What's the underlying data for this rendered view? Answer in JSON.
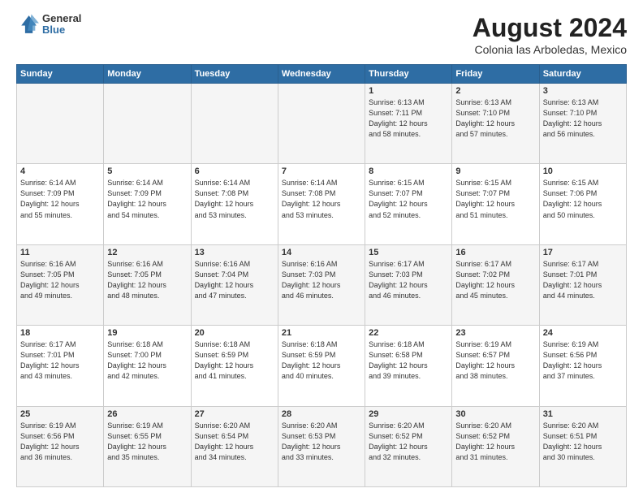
{
  "header": {
    "logo_general": "General",
    "logo_blue": "Blue",
    "title": "August 2024",
    "subtitle": "Colonia las Arboledas, Mexico"
  },
  "days_of_week": [
    "Sunday",
    "Monday",
    "Tuesday",
    "Wednesday",
    "Thursday",
    "Friday",
    "Saturday"
  ],
  "weeks": [
    [
      {
        "day": "",
        "info": ""
      },
      {
        "day": "",
        "info": ""
      },
      {
        "day": "",
        "info": ""
      },
      {
        "day": "",
        "info": ""
      },
      {
        "day": "1",
        "info": "Sunrise: 6:13 AM\nSunset: 7:11 PM\nDaylight: 12 hours\nand 58 minutes."
      },
      {
        "day": "2",
        "info": "Sunrise: 6:13 AM\nSunset: 7:10 PM\nDaylight: 12 hours\nand 57 minutes."
      },
      {
        "day": "3",
        "info": "Sunrise: 6:13 AM\nSunset: 7:10 PM\nDaylight: 12 hours\nand 56 minutes."
      }
    ],
    [
      {
        "day": "4",
        "info": "Sunrise: 6:14 AM\nSunset: 7:09 PM\nDaylight: 12 hours\nand 55 minutes."
      },
      {
        "day": "5",
        "info": "Sunrise: 6:14 AM\nSunset: 7:09 PM\nDaylight: 12 hours\nand 54 minutes."
      },
      {
        "day": "6",
        "info": "Sunrise: 6:14 AM\nSunset: 7:08 PM\nDaylight: 12 hours\nand 53 minutes."
      },
      {
        "day": "7",
        "info": "Sunrise: 6:14 AM\nSunset: 7:08 PM\nDaylight: 12 hours\nand 53 minutes."
      },
      {
        "day": "8",
        "info": "Sunrise: 6:15 AM\nSunset: 7:07 PM\nDaylight: 12 hours\nand 52 minutes."
      },
      {
        "day": "9",
        "info": "Sunrise: 6:15 AM\nSunset: 7:07 PM\nDaylight: 12 hours\nand 51 minutes."
      },
      {
        "day": "10",
        "info": "Sunrise: 6:15 AM\nSunset: 7:06 PM\nDaylight: 12 hours\nand 50 minutes."
      }
    ],
    [
      {
        "day": "11",
        "info": "Sunrise: 6:16 AM\nSunset: 7:05 PM\nDaylight: 12 hours\nand 49 minutes."
      },
      {
        "day": "12",
        "info": "Sunrise: 6:16 AM\nSunset: 7:05 PM\nDaylight: 12 hours\nand 48 minutes."
      },
      {
        "day": "13",
        "info": "Sunrise: 6:16 AM\nSunset: 7:04 PM\nDaylight: 12 hours\nand 47 minutes."
      },
      {
        "day": "14",
        "info": "Sunrise: 6:16 AM\nSunset: 7:03 PM\nDaylight: 12 hours\nand 46 minutes."
      },
      {
        "day": "15",
        "info": "Sunrise: 6:17 AM\nSunset: 7:03 PM\nDaylight: 12 hours\nand 46 minutes."
      },
      {
        "day": "16",
        "info": "Sunrise: 6:17 AM\nSunset: 7:02 PM\nDaylight: 12 hours\nand 45 minutes."
      },
      {
        "day": "17",
        "info": "Sunrise: 6:17 AM\nSunset: 7:01 PM\nDaylight: 12 hours\nand 44 minutes."
      }
    ],
    [
      {
        "day": "18",
        "info": "Sunrise: 6:17 AM\nSunset: 7:01 PM\nDaylight: 12 hours\nand 43 minutes."
      },
      {
        "day": "19",
        "info": "Sunrise: 6:18 AM\nSunset: 7:00 PM\nDaylight: 12 hours\nand 42 minutes."
      },
      {
        "day": "20",
        "info": "Sunrise: 6:18 AM\nSunset: 6:59 PM\nDaylight: 12 hours\nand 41 minutes."
      },
      {
        "day": "21",
        "info": "Sunrise: 6:18 AM\nSunset: 6:59 PM\nDaylight: 12 hours\nand 40 minutes."
      },
      {
        "day": "22",
        "info": "Sunrise: 6:18 AM\nSunset: 6:58 PM\nDaylight: 12 hours\nand 39 minutes."
      },
      {
        "day": "23",
        "info": "Sunrise: 6:19 AM\nSunset: 6:57 PM\nDaylight: 12 hours\nand 38 minutes."
      },
      {
        "day": "24",
        "info": "Sunrise: 6:19 AM\nSunset: 6:56 PM\nDaylight: 12 hours\nand 37 minutes."
      }
    ],
    [
      {
        "day": "25",
        "info": "Sunrise: 6:19 AM\nSunset: 6:56 PM\nDaylight: 12 hours\nand 36 minutes."
      },
      {
        "day": "26",
        "info": "Sunrise: 6:19 AM\nSunset: 6:55 PM\nDaylight: 12 hours\nand 35 minutes."
      },
      {
        "day": "27",
        "info": "Sunrise: 6:20 AM\nSunset: 6:54 PM\nDaylight: 12 hours\nand 34 minutes."
      },
      {
        "day": "28",
        "info": "Sunrise: 6:20 AM\nSunset: 6:53 PM\nDaylight: 12 hours\nand 33 minutes."
      },
      {
        "day": "29",
        "info": "Sunrise: 6:20 AM\nSunset: 6:52 PM\nDaylight: 12 hours\nand 32 minutes."
      },
      {
        "day": "30",
        "info": "Sunrise: 6:20 AM\nSunset: 6:52 PM\nDaylight: 12 hours\nand 31 minutes."
      },
      {
        "day": "31",
        "info": "Sunrise: 6:20 AM\nSunset: 6:51 PM\nDaylight: 12 hours\nand 30 minutes."
      }
    ]
  ]
}
